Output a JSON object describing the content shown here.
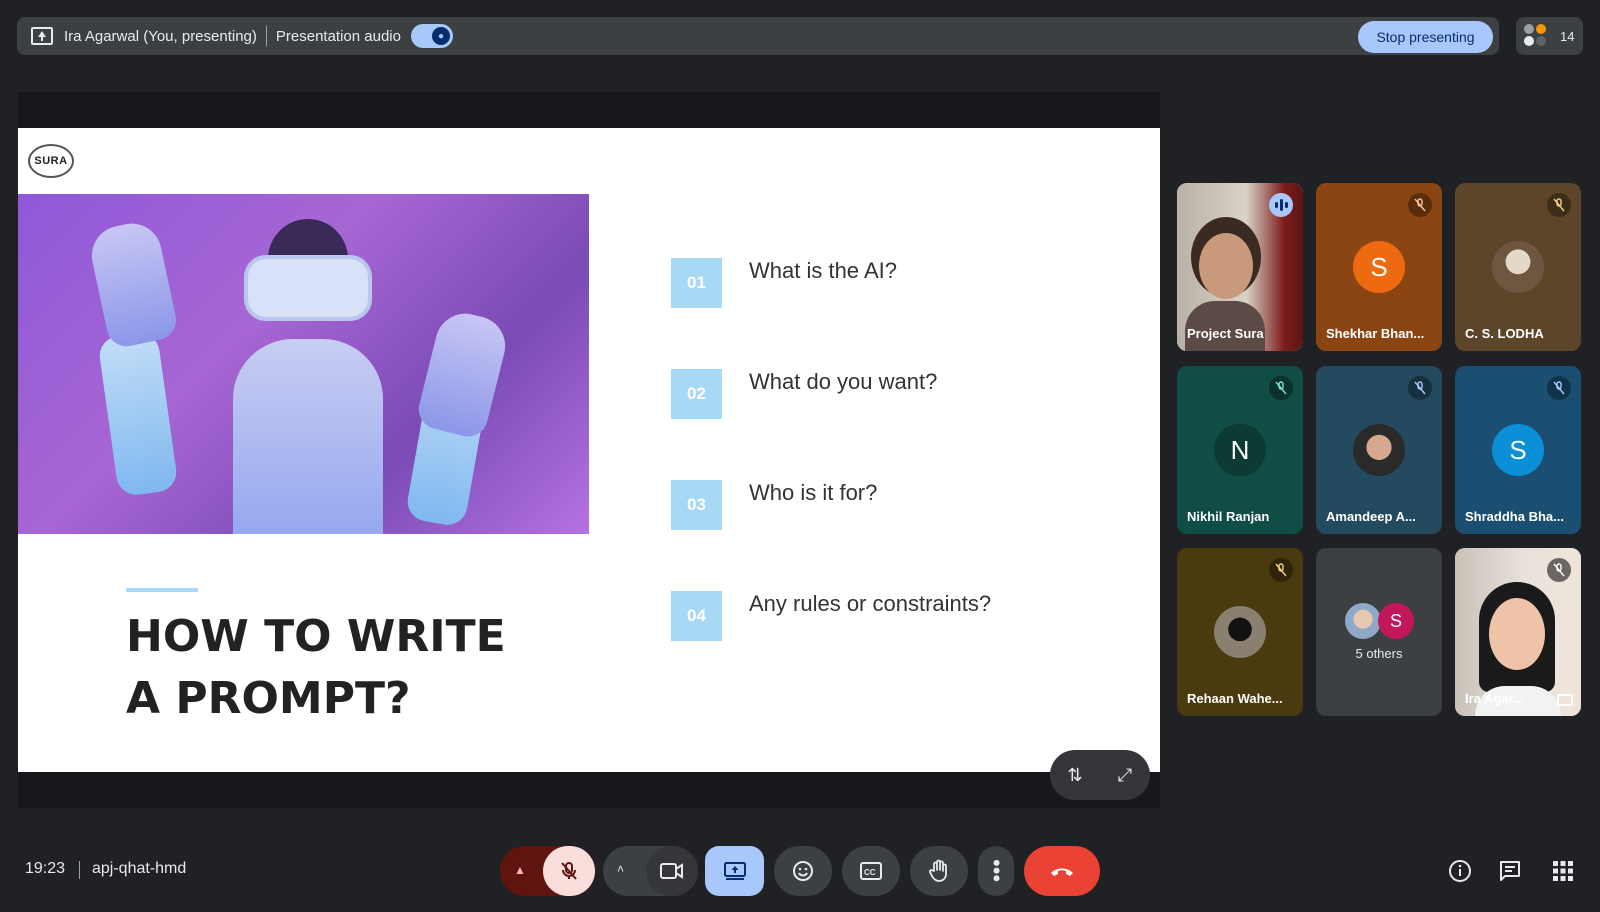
{
  "topbar": {
    "presenter": "Ira Agarwal (You, presenting)",
    "audio_label": "Presentation audio",
    "stop_label": "Stop presenting",
    "people_count": "14"
  },
  "slide": {
    "logo": "SURA",
    "title_line1": "HOW TO WRITE",
    "title_line2": "A PROMPT?",
    "items": [
      {
        "num": "01",
        "text": "What is the AI?"
      },
      {
        "num": "02",
        "text": "What do you want?"
      },
      {
        "num": "03",
        "text": "Who is it for?"
      },
      {
        "num": "04",
        "text": "Any rules or constraints?"
      }
    ]
  },
  "participants": [
    {
      "name": "Project Sura",
      "status": "speaking"
    },
    {
      "name": "Shekhar Bhan...",
      "initial": "S",
      "status": "muted"
    },
    {
      "name": "C. S. LODHA",
      "status": "muted"
    },
    {
      "name": "Nikhil Ranjan",
      "initial": "N",
      "status": "muted"
    },
    {
      "name": "Amandeep A...",
      "status": "muted"
    },
    {
      "name": "Shraddha Bha...",
      "initial": "S",
      "status": "muted"
    },
    {
      "name": "Rehaan Wahe...",
      "status": "muted"
    },
    {
      "name": "5 others",
      "initial": "S"
    },
    {
      "name": "Ira Agar...",
      "status": "muted"
    }
  ],
  "footer": {
    "time": "19:23",
    "meeting_code": "apj-qhat-hmd"
  },
  "colors": {
    "accent": "#a8c7fa",
    "end_call": "#ea4335",
    "slide_box": "#a7d9f4",
    "mic_off_bg": "#f9dedc"
  }
}
